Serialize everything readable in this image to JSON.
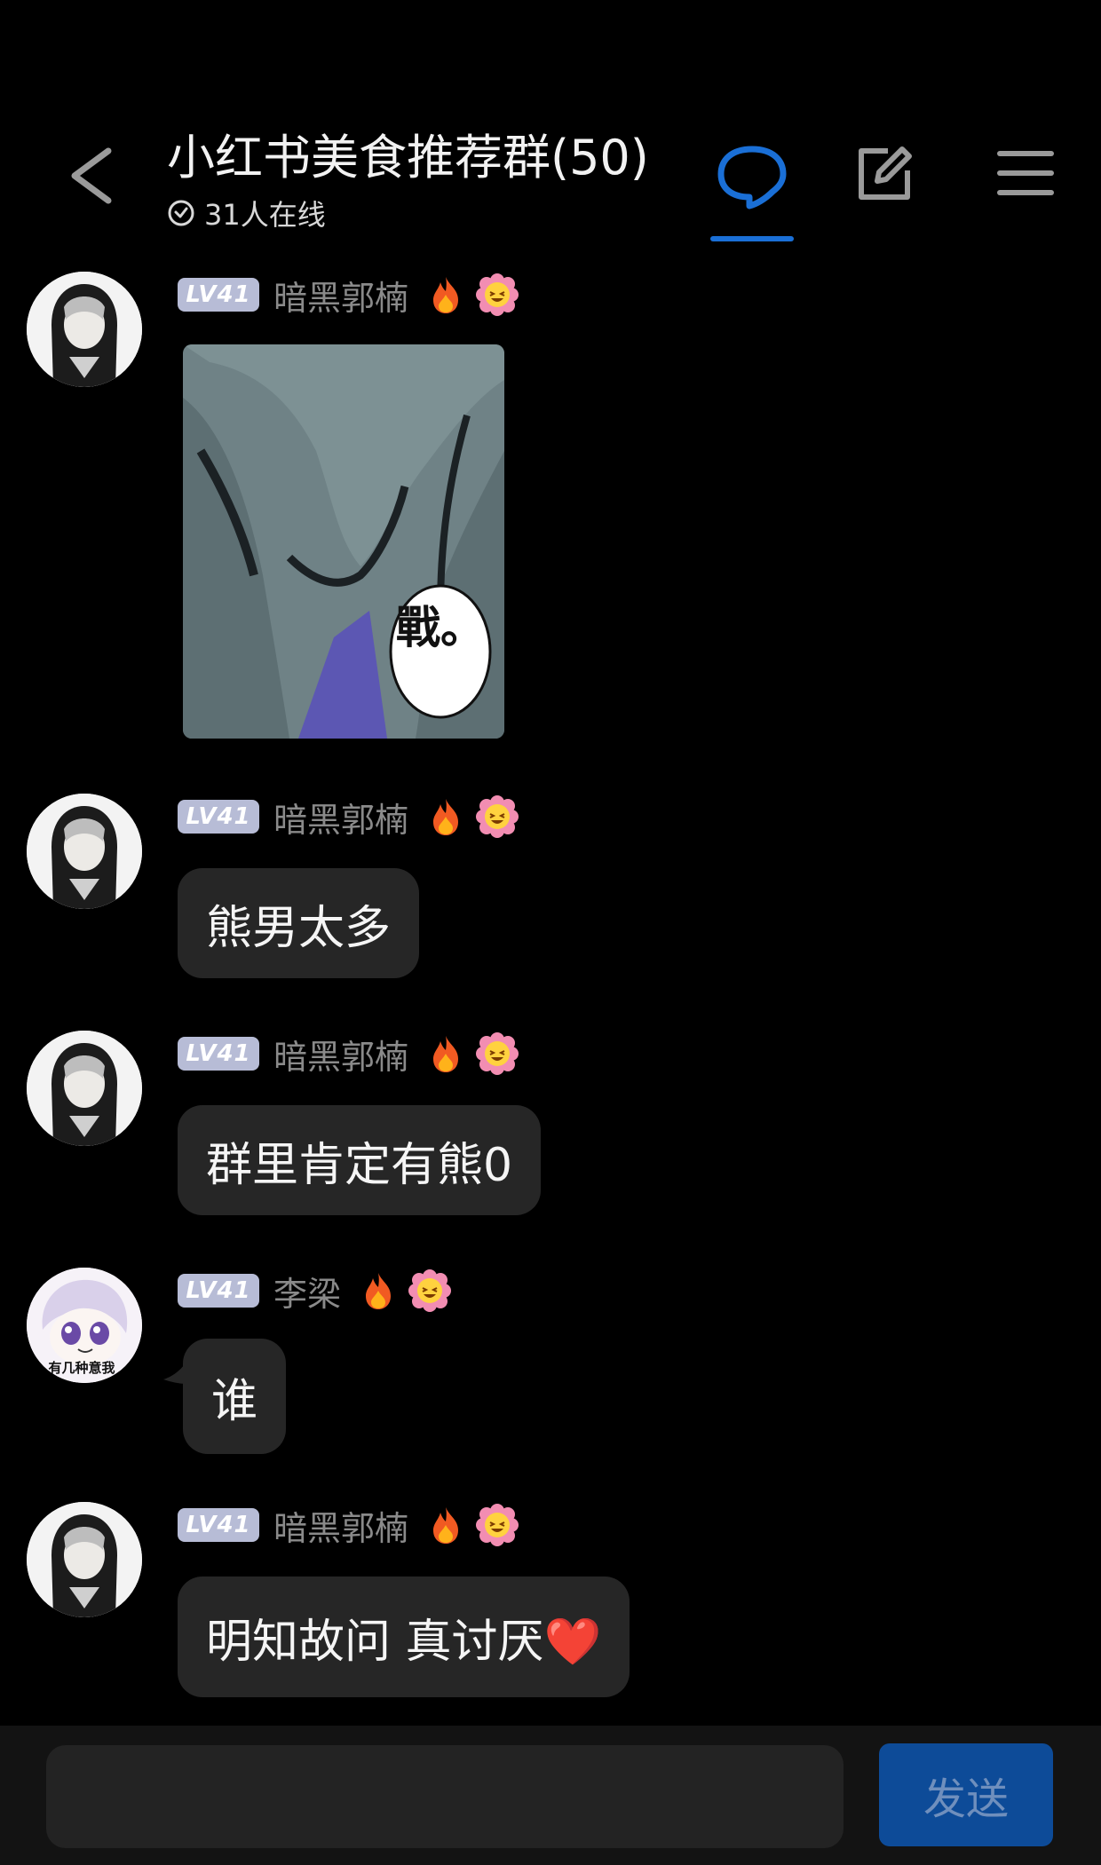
{
  "header": {
    "title": "小红书美食推荐群(50)",
    "online_text": "31人在线",
    "accent_color": "#1a6fd6",
    "icons": [
      "back-arrow-icon",
      "clock-check-icon",
      "chat-bubble-icon",
      "edit-icon",
      "menu-icon"
    ]
  },
  "messages": [
    {
      "level": "LV41",
      "user": "暗黑郭楠",
      "type": "image",
      "image_text": "戰。"
    },
    {
      "level": "LV41",
      "user": "暗黑郭楠",
      "type": "text",
      "text": "熊男太多"
    },
    {
      "level": "LV41",
      "user": "暗黑郭楠",
      "type": "text",
      "text": "群里肯定有熊0"
    },
    {
      "level": "LV41",
      "user": "李梁",
      "type": "text",
      "text": "谁",
      "avatar_caption": "有几种意我"
    },
    {
      "level": "LV41",
      "user": "暗黑郭楠",
      "type": "text",
      "text": "明知故问 真讨厌❤️"
    }
  ],
  "input_bar": {
    "placeholder": "",
    "send_label": "发送"
  }
}
